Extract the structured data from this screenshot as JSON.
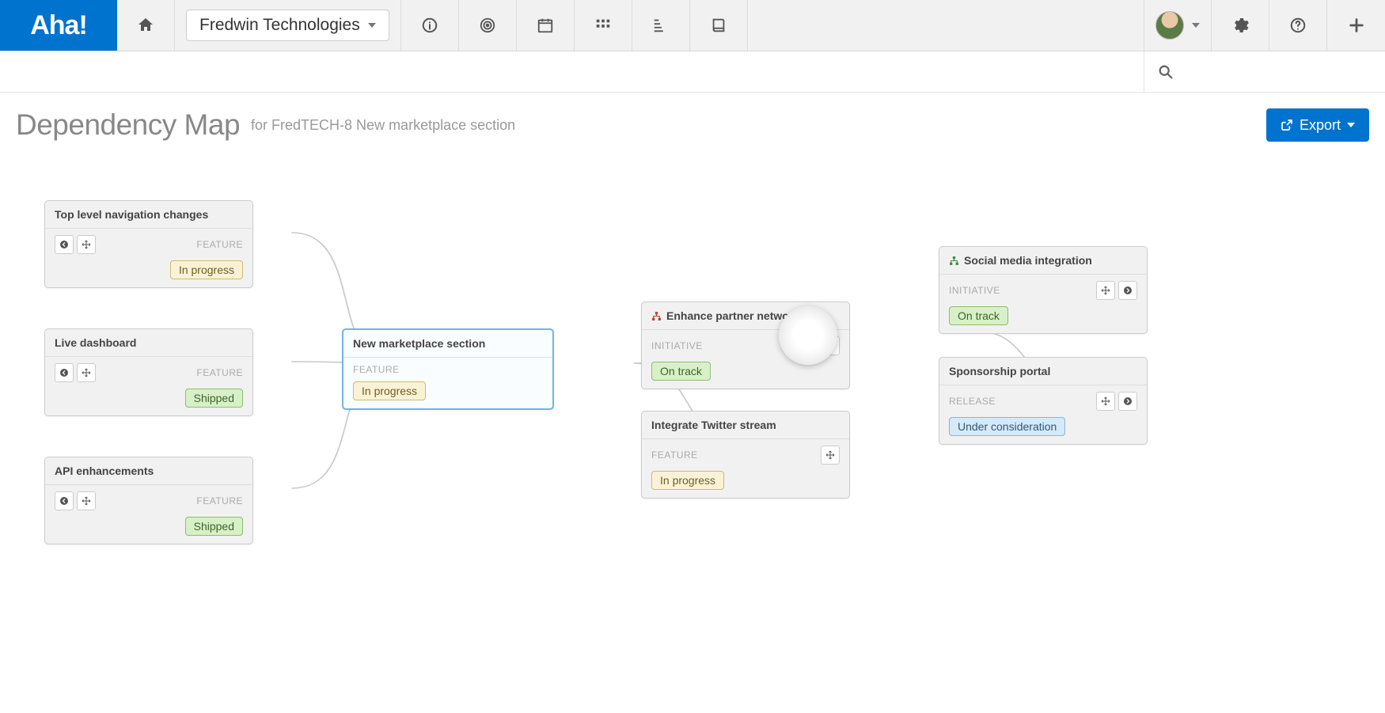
{
  "brand": "Aha!",
  "workspace": "Fredwin Technologies",
  "page": {
    "title": "Dependency Map",
    "subtitle": "for FredTECH-8 New marketplace section",
    "export_label": "Export"
  },
  "type_labels": {
    "feature": "FEATURE",
    "initiative": "INITIATIVE",
    "release": "RELEASE"
  },
  "status_labels": {
    "in_progress": "In progress",
    "shipped": "Shipped",
    "on_track": "On track",
    "under_consideration": "Under consideration"
  },
  "nodes": {
    "top_nav": {
      "title": "Top level navigation changes",
      "type": "feature",
      "status": "in_progress",
      "status_class": "progress",
      "nav": "left"
    },
    "live_dash": {
      "title": "Live dashboard",
      "type": "feature",
      "status": "shipped",
      "status_class": "shipped",
      "nav": "left"
    },
    "api": {
      "title": "API enhancements",
      "type": "feature",
      "status": "shipped",
      "status_class": "shipped",
      "nav": "left"
    },
    "center": {
      "title": "New marketplace section",
      "type": "feature",
      "status": "in_progress",
      "status_class": "progress",
      "nav": "none"
    },
    "partner": {
      "title": "Enhance partner network",
      "type": "initiative",
      "status": "on_track",
      "status_class": "ontrack",
      "nav": "right",
      "icon": "hier-red"
    },
    "twitter": {
      "title": "Integrate Twitter stream",
      "type": "feature",
      "status": "in_progress",
      "status_class": "progress",
      "nav": "move-only"
    },
    "social": {
      "title": "Social media integration",
      "type": "initiative",
      "status": "on_track",
      "status_class": "ontrack",
      "nav": "right",
      "icon": "hier-green"
    },
    "sponsor": {
      "title": "Sponsorship portal",
      "type": "release",
      "status": "under_consideration",
      "status_class": "consider",
      "nav": "right"
    }
  }
}
